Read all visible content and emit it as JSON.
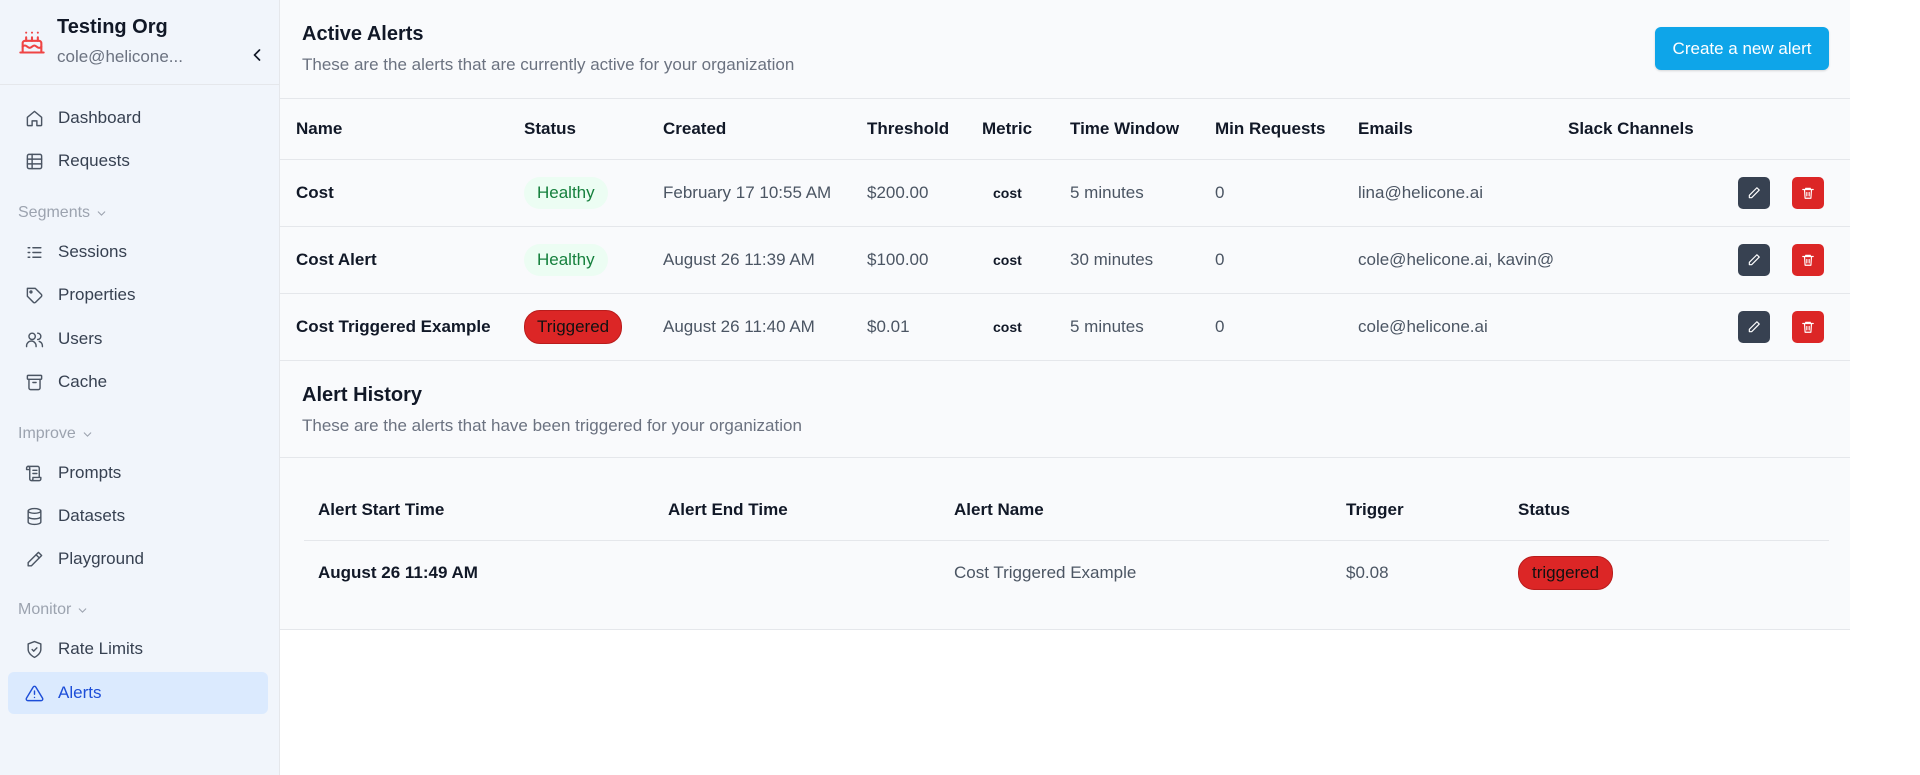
{
  "org": {
    "name": "Testing Org",
    "email": "cole@helicone..."
  },
  "nav": {
    "dashboard": "Dashboard",
    "requests": "Requests",
    "segments": "Segments",
    "sessions": "Sessions",
    "properties": "Properties",
    "users": "Users",
    "cache": "Cache",
    "improve": "Improve",
    "prompts": "Prompts",
    "datasets": "Datasets",
    "playground": "Playground",
    "monitor": "Monitor",
    "rate_limits": "Rate Limits",
    "alerts": "Alerts"
  },
  "active_alerts": {
    "title": "Active Alerts",
    "subtitle": "These are the alerts that are currently active for your organization",
    "create_button": "Create a new alert",
    "columns": [
      "Name",
      "Status",
      "Created",
      "Threshold",
      "Metric",
      "Time Window",
      "Min Requests",
      "Emails",
      "Slack Channels"
    ],
    "rows": [
      {
        "name": "Cost",
        "status": "Healthy",
        "created": "February 17 10:55 AM",
        "threshold": "$200.00",
        "metric": "cost",
        "time_window": "5 minutes",
        "min_requests": "0",
        "emails": "lina@helicone.ai",
        "slack": ""
      },
      {
        "name": "Cost Alert",
        "status": "Healthy",
        "created": "August 26 11:39 AM",
        "threshold": "$100.00",
        "metric": "cost",
        "time_window": "30 minutes",
        "min_requests": "0",
        "emails": "cole@helicone.ai, kavin@",
        "slack": ""
      },
      {
        "name": "Cost Triggered Example",
        "status": "Triggered",
        "created": "August 26 11:40 AM",
        "threshold": "$0.01",
        "metric": "cost",
        "time_window": "5 minutes",
        "min_requests": "0",
        "emails": "cole@helicone.ai",
        "slack": ""
      }
    ]
  },
  "alert_history": {
    "title": "Alert History",
    "subtitle": "These are the alerts that have been triggered for your organization",
    "columns": [
      "Alert Start Time",
      "Alert End Time",
      "Alert Name",
      "Trigger",
      "Status"
    ],
    "rows": [
      {
        "start": "August 26 11:49 AM",
        "end": "",
        "name": "Cost Triggered Example",
        "trigger": "$0.08",
        "status": "triggered"
      }
    ]
  },
  "colors": {
    "primary": "#0ea5e9",
    "danger": "#dc2626",
    "healthy_bg": "#ecfdf3",
    "healthy_text": "#15803d",
    "edit_btn": "#374151",
    "active_nav": "#dbeafe"
  },
  "icons": [
    "cake-icon",
    "chevron-left-icon",
    "home-icon",
    "table-icon",
    "chevron-down-icon",
    "list-icon",
    "tag-icon",
    "users-icon",
    "archive-icon",
    "scroll-icon",
    "database-icon",
    "pencil-icon",
    "shield-icon",
    "alert-triangle-icon",
    "edit-icon",
    "trash-icon"
  ]
}
